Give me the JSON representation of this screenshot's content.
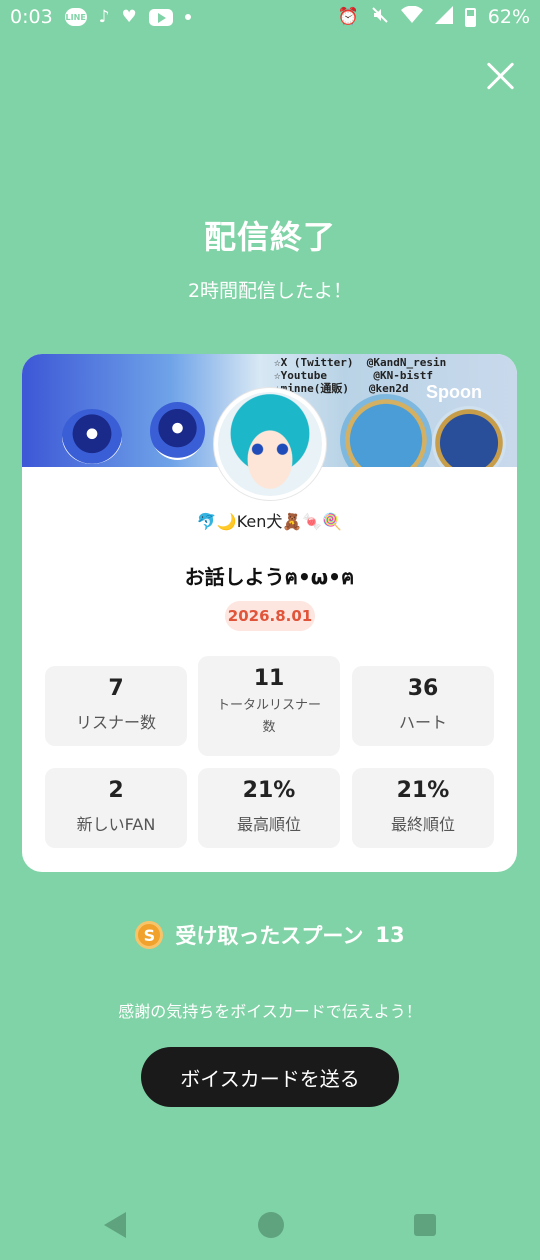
{
  "status_bar": {
    "time": "0:03",
    "battery": "62%",
    "icons": [
      "line-icon",
      "tiktok-icon",
      "heart-icon",
      "youtube-icon",
      "dot-icon",
      "alarm-icon",
      "mute-icon",
      "wifi-icon",
      "signal-icon",
      "battery-icon"
    ]
  },
  "header": {
    "title": "配信終了",
    "subtitle": "2時間配信したよ！"
  },
  "card": {
    "banner_text": "☆X (Twitter)  @KandN_resin\n☆Youtube       @KN-bistf\n☆minne(通販)   @ken2d",
    "banner_logo": "Spoon",
    "user_name": "🐬🌙Ken犬🧸🍬🍭",
    "room_title": "お話しようฅ•ω•ฅ",
    "date": "2026.8.01",
    "stats": [
      {
        "value": "7",
        "label": "リスナー数"
      },
      {
        "value": "11",
        "label": "トータルリスナー数"
      },
      {
        "value": "36",
        "label": "ハート"
      },
      {
        "value": "2",
        "label": "新しいFAN"
      },
      {
        "value": "21%",
        "label": "最高順位"
      },
      {
        "value": "21%",
        "label": "最終順位"
      }
    ]
  },
  "spoons": {
    "coin_glyph": "S",
    "label": "受け取ったスプーン",
    "count": "13"
  },
  "thanks_text": "感謝の気持ちをボイスカードで伝えよう！",
  "voice_button_label": "ボイスカードを送る",
  "colors": {
    "background": "#80D3A6",
    "button": "#1a1a1a",
    "date_badge_text": "#e0543a",
    "coin": "#f0a22c"
  }
}
